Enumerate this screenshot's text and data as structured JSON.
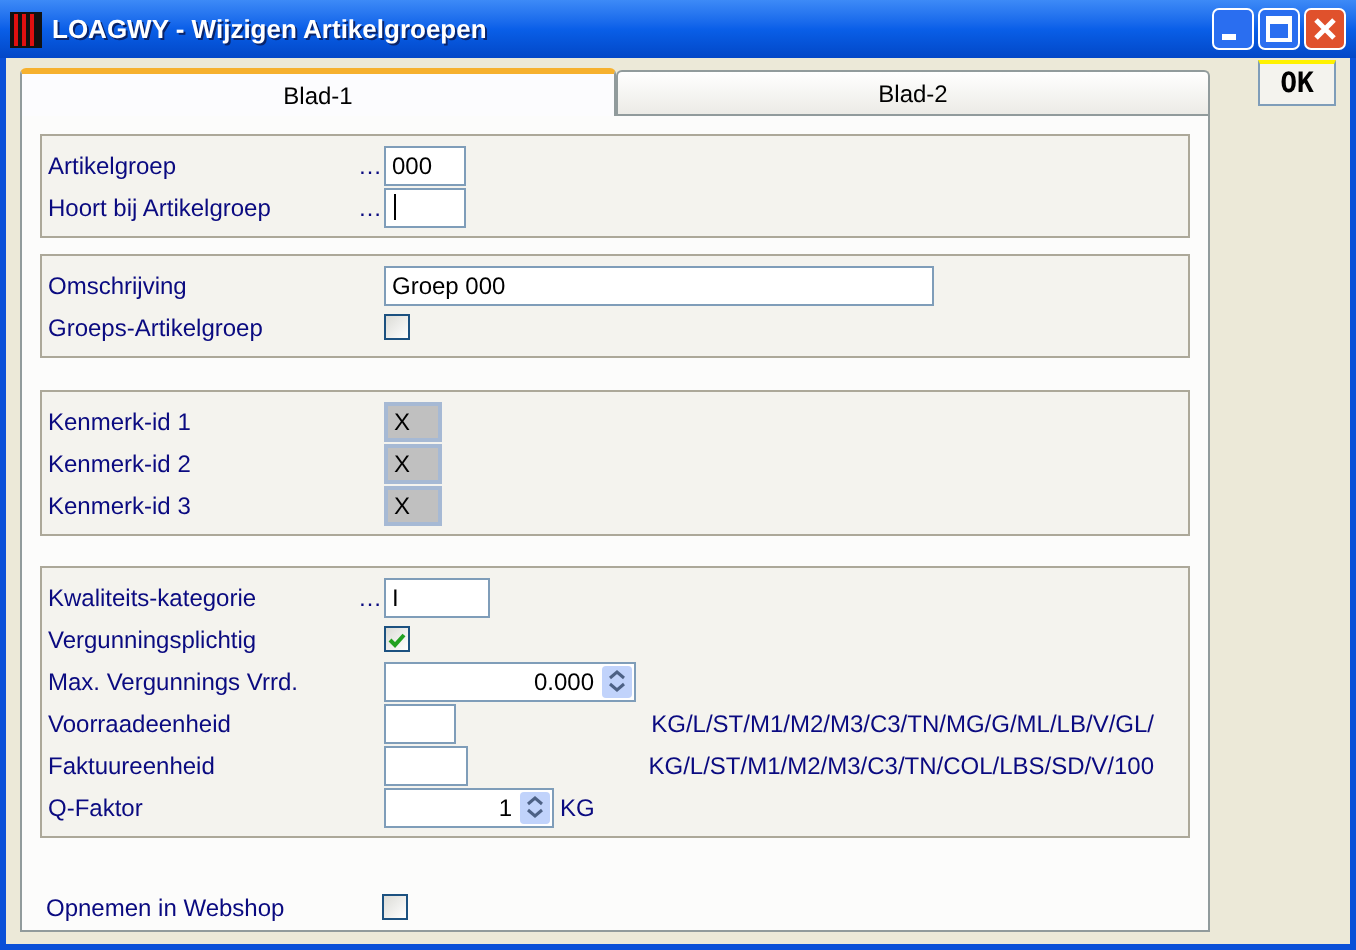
{
  "window": {
    "title": "LOAGWY - Wijzigen Artikelgroepen"
  },
  "tabs": [
    {
      "label": "Blad-1",
      "selected": true
    },
    {
      "label": "Blad-2",
      "selected": false
    }
  ],
  "ok_button": "OK",
  "groups": [
    {
      "framed": true,
      "rows": [
        {
          "kind": "text",
          "label": "Artikelgroep",
          "prefix": "…",
          "value": "000",
          "focused": false
        },
        {
          "kind": "text",
          "label": "Hoort bij Artikelgroep",
          "prefix": "…",
          "value": "",
          "focused": true
        }
      ]
    },
    {
      "framed": true,
      "rows": [
        {
          "kind": "text",
          "label": "Omschrijving",
          "value": "Groep 000",
          "focused": false
        },
        {
          "kind": "checkbox",
          "label": "Groeps-Artikelgroep",
          "checked": false
        }
      ]
    },
    {
      "framed": true,
      "rows": [
        {
          "kind": "xbox",
          "label": "Kenmerk-id 1",
          "value": "X"
        },
        {
          "kind": "xbox",
          "label": "Kenmerk-id 2",
          "value": "X"
        },
        {
          "kind": "xbox",
          "label": "Kenmerk-id 3",
          "value": "X"
        }
      ]
    },
    {
      "framed": true,
      "rows": [
        {
          "kind": "text",
          "label": "Kwaliteits-kategorie",
          "prefix": "…",
          "value": "I",
          "focused": false
        },
        {
          "kind": "checkbox",
          "label": "Vergunningsplichtig",
          "checked": true
        },
        {
          "kind": "spin",
          "label": "Max. Vergunnings Vrrd.",
          "value": "0.000"
        },
        {
          "kind": "text",
          "label": "Voorraadeenheid",
          "value": "",
          "focused": false,
          "hint": "KG/L/ST/M1/M2/M3/C3/TN/MG/G/ML/LB/V/GL/"
        },
        {
          "kind": "text",
          "label": "Faktuureenheid",
          "value": "",
          "focused": false,
          "hint": "KG/L/ST/M1/M2/M3/C3/TN/COL/LBS/SD/V/100"
        },
        {
          "kind": "spin",
          "label": "Q-Faktor",
          "value": "1",
          "unit": "KG"
        }
      ]
    },
    {
      "framed": false,
      "rows": [
        {
          "kind": "checkbox",
          "label": "Opnemen in Webshop",
          "checked": false
        }
      ]
    }
  ]
}
